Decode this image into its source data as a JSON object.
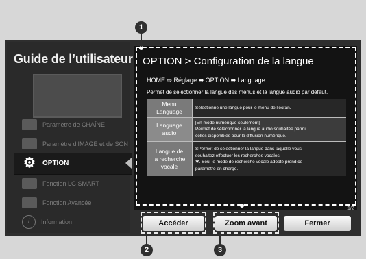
{
  "guide": {
    "title": "Guide de l’utilisateur"
  },
  "sidebar": {
    "items": [
      {
        "label": "Paramètre de CHAÎNE",
        "icon": "antenna-icon"
      },
      {
        "label": "Paramètre d’IMAGE et de SON",
        "icon": "picture-sound-icon"
      },
      {
        "label": "OPTION",
        "icon": "gear-icon"
      },
      {
        "label": "Fonction LG SMART",
        "icon": "smart-tv-icon"
      },
      {
        "label": "Fonction Avancée",
        "icon": "advanced-icon"
      },
      {
        "label": "Information",
        "icon": "info-icon"
      }
    ],
    "active_index": 2
  },
  "content": {
    "title": "OPTION > Configuration de la langue",
    "breadcrumb": "HOME ⇨ Réglage ➡ OPTION ➡ Language",
    "description": "Permet de sélectionner la langue des menus et la langue audio par défaut.",
    "rows": [
      {
        "key": [
          "Menu",
          "Language"
        ],
        "value": [
          "Sélectionne une langue pour le menu de l’écran."
        ]
      },
      {
        "key": [
          "Language",
          "audio"
        ],
        "value": [
          "[En mode numérique seulement]",
          "Permet de sélectionner la langue audio souhaitée parmi",
          "celles disponibles pour la diffusion numérique."
        ]
      },
      {
        "key": [
          "Langue de",
          "la recherche",
          "vocale"
        ],
        "value": [
          "SPermet de sélectionner la langue dans laquelle vous",
          "souhaitez effectuer les recherches vocales.",
          "✱. Seul le mode de recherche vocale adopté prend ce",
          "paramètre en charge."
        ]
      }
    ],
    "page_indicator": "1/2"
  },
  "buttons": {
    "access": "Accéder",
    "zoom": "Zoom avant",
    "close": "Fermer"
  },
  "callouts": {
    "c1": "1",
    "c2": "2",
    "c3": "3"
  },
  "colors": {
    "background": "#d7d7d7",
    "panel": "#131313",
    "row_key": "#7a7a7a",
    "badge": "#2f2f2f"
  }
}
